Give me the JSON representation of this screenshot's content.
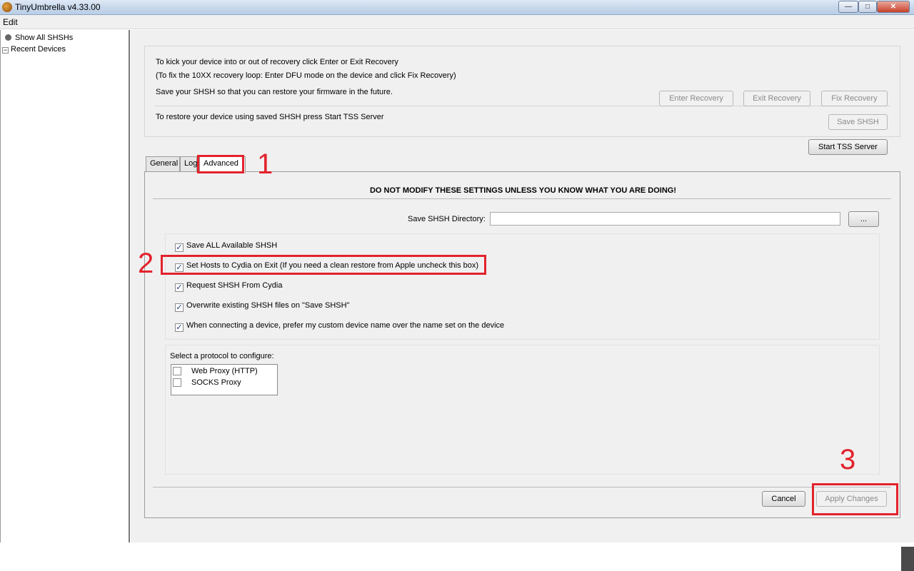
{
  "window": {
    "title": "TinyUmbrella v4.33.00",
    "minimize": "—",
    "maximize": "□",
    "close": "✕"
  },
  "menu": {
    "edit": "Edit"
  },
  "sidebar": {
    "items": [
      {
        "label": "Show All SHSHs",
        "icon": "device-dot-icon"
      },
      {
        "label": "Recent Devices",
        "icon": "collapse-box-icon",
        "expander": "−"
      }
    ]
  },
  "top_panel": {
    "line1": "To kick your device into or out of recovery click Enter or Exit Recovery",
    "line2": "(To fix the 10XX recovery loop: Enter DFU mode on the device and click Fix Recovery)",
    "line3": "Save your SHSH so that you can restore your firmware in the future.",
    "line4": "To restore your device using saved SHSH press Start TSS Server",
    "enter_recovery": "Enter Recovery",
    "exit_recovery": "Exit Recovery",
    "fix_recovery": "Fix Recovery",
    "save_shsh": "Save SHSH",
    "start_tss": "Start TSS Server"
  },
  "tabs": [
    {
      "label": "General"
    },
    {
      "label": "Log"
    },
    {
      "label": "Advanced",
      "selected": true
    }
  ],
  "advanced": {
    "warning": "DO NOT MODIFY THESE SETTINGS UNLESS YOU KNOW WHAT YOU ARE DOING!",
    "dir_label": "Save SHSH Directory:",
    "dir_value": "",
    "browse": "...",
    "options": [
      {
        "label": "Save ALL Available SHSH",
        "checked": true
      },
      {
        "label": "Set Hosts to Cydia on Exit (If you need a clean restore from Apple uncheck this box)",
        "checked": true
      },
      {
        "label": "Request SHSH From Cydia",
        "checked": true
      },
      {
        "label": "Overwrite existing SHSH files on \"Save SHSH\"",
        "checked": true
      },
      {
        "label": "When connecting a device, prefer my custom device name over the name set on the device",
        "checked": true
      }
    ],
    "protocol_label": "Select a protocol to configure:",
    "protocols": [
      {
        "label": "Web Proxy (HTTP)",
        "checked": false
      },
      {
        "label": "SOCKS Proxy",
        "checked": false
      }
    ],
    "cancel": "Cancel",
    "apply": "Apply Changes"
  },
  "annotations": {
    "n1": "1",
    "n2": "2",
    "n3": "3",
    "color": "#e3222c"
  },
  "check_mark": "✓"
}
